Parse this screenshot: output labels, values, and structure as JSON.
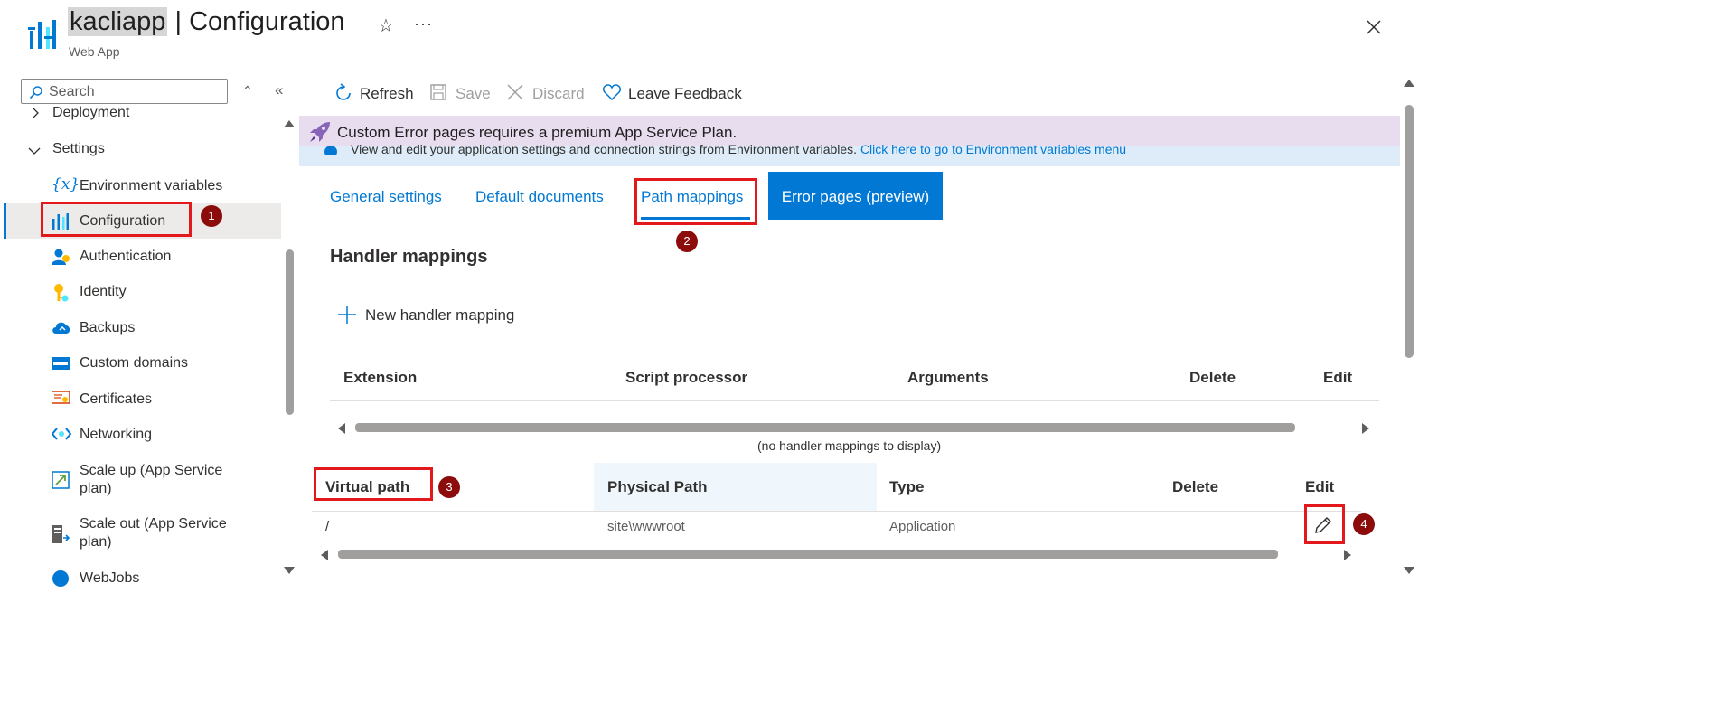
{
  "header": {
    "app_name": "kacliapp",
    "separator": " | ",
    "page": "Configuration",
    "subtitle": "Web App",
    "more": "···"
  },
  "sidebar": {
    "search_placeholder": "Search",
    "items": [
      {
        "label": "Deployment",
        "icon": "chevron-right-icon"
      },
      {
        "label": "Settings",
        "icon": "chevron-down-icon"
      },
      {
        "label": "Environment variables",
        "icon": "variable-icon"
      },
      {
        "label": "Configuration",
        "icon": "configuration-icon",
        "selected": true
      },
      {
        "label": "Authentication",
        "icon": "authentication-icon"
      },
      {
        "label": "Identity",
        "icon": "identity-icon"
      },
      {
        "label": "Backups",
        "icon": "backups-icon"
      },
      {
        "label": "Custom domains",
        "icon": "custom-domains-icon"
      },
      {
        "label": "Certificates",
        "icon": "certificates-icon"
      },
      {
        "label": "Networking",
        "icon": "networking-icon"
      },
      {
        "label": "Scale up (App Service plan)",
        "line1": "Scale up (App Service",
        "line2": "plan)",
        "icon": "scale-up-icon"
      },
      {
        "label": "Scale out (App Service plan)",
        "line1": "Scale out (App Service",
        "line2": "plan)",
        "icon": "scale-out-icon"
      },
      {
        "label": "WebJobs",
        "icon": "webjobs-icon"
      }
    ]
  },
  "toolbar": {
    "refresh": "Refresh",
    "save": "Save",
    "discard": "Discard",
    "feedback": "Leave Feedback"
  },
  "banner": {
    "message": "Custom Error pages requires a premium App Service Plan.",
    "info": "View and edit your application settings and connection strings from Environment variables. ",
    "info_link": "Click here to go to Environment variables menu"
  },
  "tabs": {
    "general": "General settings",
    "default_docs": "Default documents",
    "path_mappings": "Path mappings",
    "error_pages": "Error pages (preview)"
  },
  "handler": {
    "title": "Handler mappings",
    "new_button": "New handler mapping",
    "columns": [
      "Extension",
      "Script processor",
      "Arguments",
      "Delete",
      "Edit"
    ],
    "empty": "(no handler mappings to display)"
  },
  "vpaths": {
    "columns": [
      "Virtual path",
      "Physical Path",
      "Type",
      "Delete",
      "Edit"
    ],
    "rows": [
      {
        "virtual": "/",
        "physical": "site\\wwwroot",
        "type": "Application"
      }
    ]
  },
  "annotations": [
    "1",
    "2",
    "3",
    "4"
  ],
  "colors": {
    "accent": "#0078d4",
    "highlight_red": "#e3181c",
    "badge": "#8c0c0c",
    "banner_purple": "#e8dcef",
    "banner_blue": "#deecf9"
  }
}
